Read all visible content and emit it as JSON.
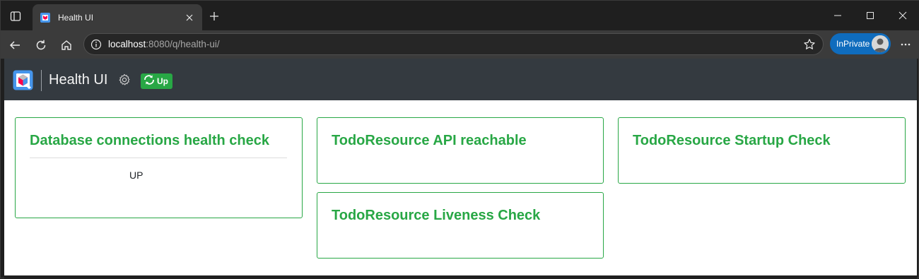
{
  "browser": {
    "tab_title": "Health UI",
    "url_host": "localhost",
    "url_path": ":8080/q/health-ui/",
    "inprivate_label": "InPrivate"
  },
  "app": {
    "title": "Health UI",
    "status": "Up",
    "status_color": "#28a745",
    "header_bg": "#343a40"
  },
  "checks": [
    {
      "name": "Database connections health check",
      "status": "UP"
    },
    {
      "name": "TodoResource API reachable"
    },
    {
      "name": "TodoResource Startup Check"
    },
    {
      "name": "TodoResource Liveness Check"
    }
  ],
  "icons": {
    "sidebar": "sidebar-icon",
    "favicon": "quarkus-logo",
    "close": "close-icon",
    "new_tab": "plus-icon",
    "minimize": "minimize-icon",
    "maximize": "maximize-icon",
    "back": "back-arrow-icon",
    "reload": "reload-icon",
    "home": "home-icon",
    "info": "info-icon",
    "favorite": "star-icon",
    "more": "more-icon",
    "settings": "gear-icon",
    "status": "sync-icon"
  }
}
